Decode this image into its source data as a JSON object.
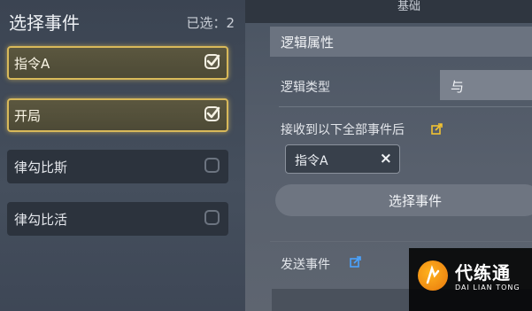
{
  "left_panel": {
    "title": "选择事件",
    "selected_count": "已选：2",
    "events": [
      {
        "label": "指令A",
        "checked": true
      },
      {
        "label": "开局",
        "checked": true
      },
      {
        "label": "律勾比斯",
        "checked": false
      },
      {
        "label": "律勾比活",
        "checked": false
      }
    ]
  },
  "right_panel": {
    "top_tab": "基础",
    "section_title": "逻辑属性",
    "logic_type_label": "逻辑类型",
    "logic_type_value": "与",
    "receive_label": "接收到以下全部事件后",
    "received_tag": "指令A",
    "received_tag_close": "×",
    "select_events_button": "选择事件",
    "send_events_label": "发送事件"
  },
  "watermark": {
    "title": "代练通",
    "subtitle": "DAI LIAN TONG"
  },
  "colors": {
    "selected_border": "#d8b95a",
    "link_icon": "#f1c232",
    "send_icon": "#4aa3ff"
  }
}
